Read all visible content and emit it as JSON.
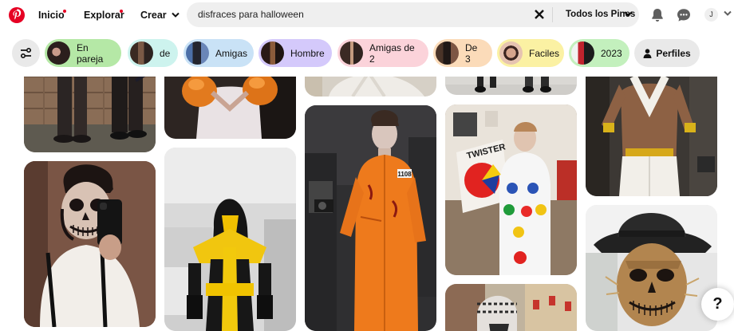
{
  "header": {
    "nav": [
      {
        "label": "Inicio",
        "dot": true
      },
      {
        "label": "Explorar",
        "dot": true
      },
      {
        "label": "Crear",
        "dot": false
      }
    ],
    "search": {
      "value": "disfraces para halloween",
      "scope": "Todos los Pines"
    },
    "account_initial": "J"
  },
  "filters": {
    "chips": [
      {
        "label": "En pareja",
        "bg": "#b5e8a6"
      },
      {
        "label": "de",
        "bg": "#cdf3ee"
      },
      {
        "label": "Amigas",
        "bg": "#c9e2f6"
      },
      {
        "label": "Hombre",
        "bg": "#d4c9fb"
      },
      {
        "label": "Amigas de 2",
        "bg": "#fbd3da"
      },
      {
        "label": "De 3",
        "bg": "#fbdbb9"
      },
      {
        "label": "Faciles",
        "bg": "#fbf1a3"
      },
      {
        "label": "2023",
        "bg": "#c3f0bd"
      }
    ],
    "profiles_label": "Perfiles"
  },
  "pins": [
    {
      "name": "pin-couple-street"
    },
    {
      "name": "pin-boxer"
    },
    {
      "name": "pin-white-costume"
    },
    {
      "name": "pin-street-legs"
    },
    {
      "name": "pin-aladdin"
    },
    {
      "name": "pin-skull-makeup-selfie"
    },
    {
      "name": "pin-scorpion-costume"
    },
    {
      "name": "pin-orange-prisoner"
    },
    {
      "name": "pin-twister-costume"
    },
    {
      "name": "pin-scarecrow-makeup"
    },
    {
      "name": "pin-street-crowd"
    }
  ],
  "prisoner_tag": "1108",
  "twister_sign": "TWISTER",
  "help_label": "?"
}
